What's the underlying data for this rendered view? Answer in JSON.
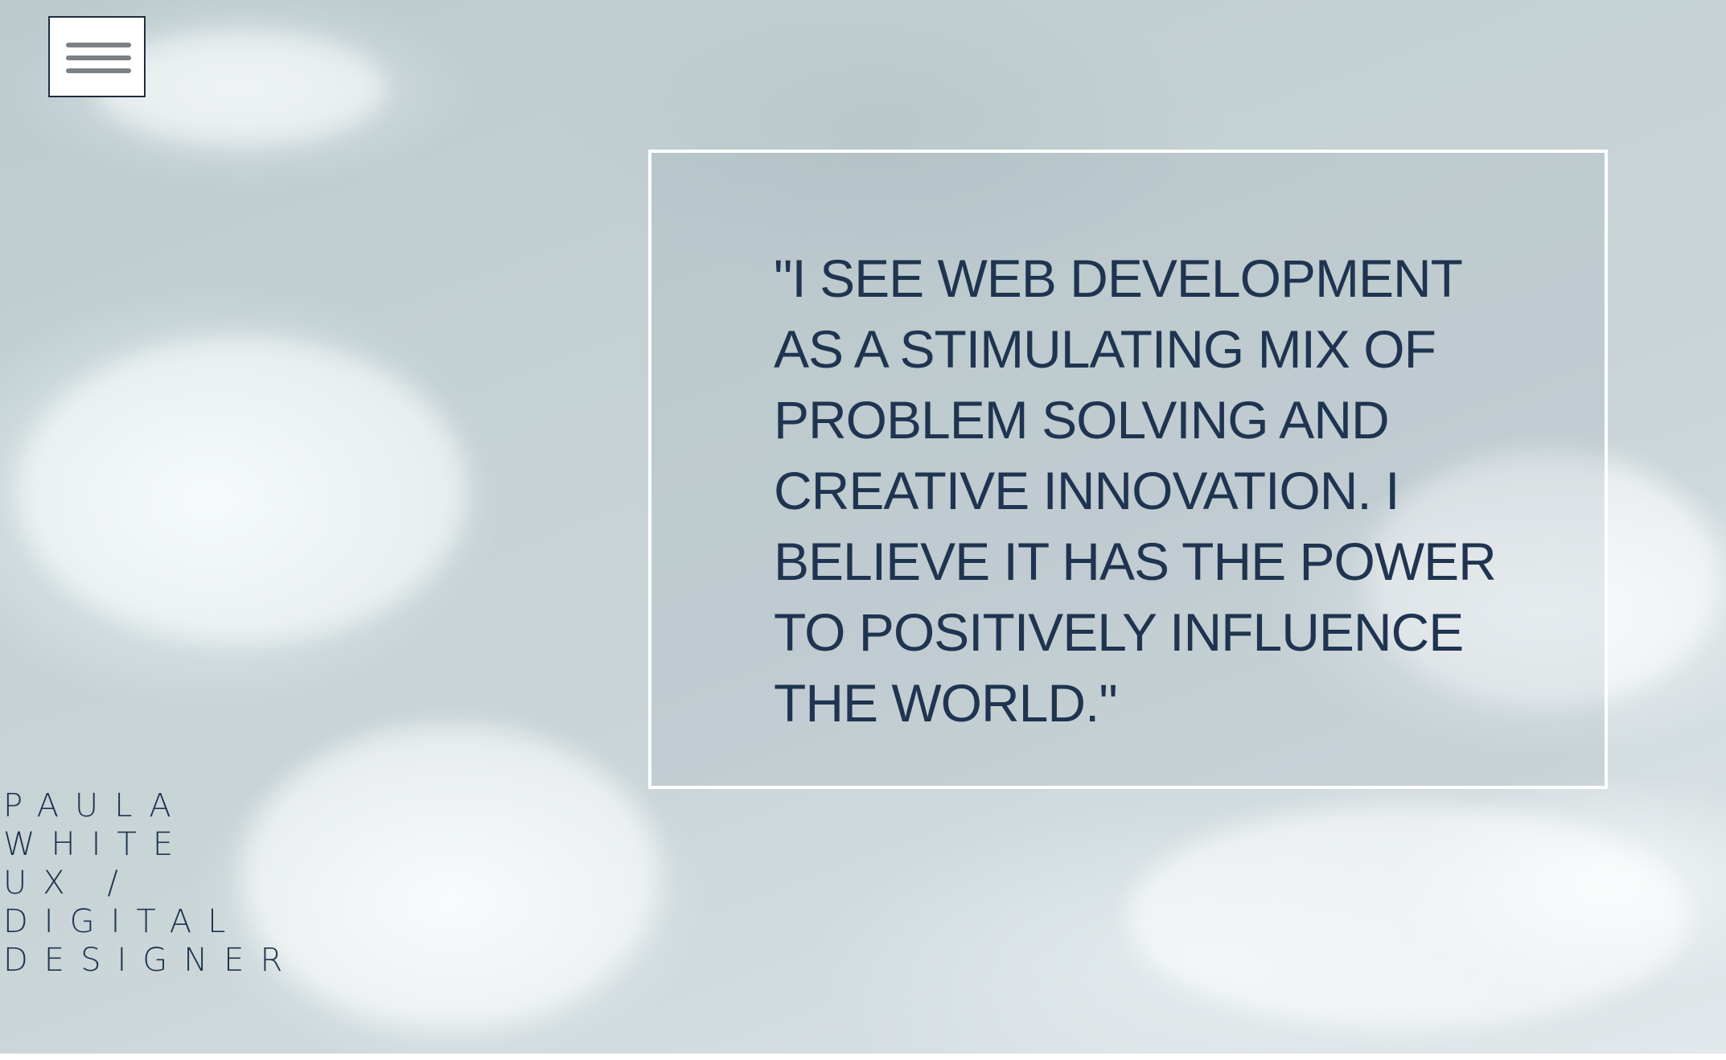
{
  "menu": {
    "icon": "hamburger-icon"
  },
  "quote": {
    "text": "\"I SEE WEB DEVELOPMENT AS A STIMULATING MIX OF PROBLEM SOLVING AND CREATIVE INNOVATION. I BELIEVE IT HAS THE POWER TO POSITIVELY INFLUENCE THE WORLD.\""
  },
  "profile": {
    "lines": [
      "PAULA",
      "WHITE",
      "UX /",
      "DIGITAL",
      "DESIGNER"
    ]
  },
  "colors": {
    "text": "#1f3450",
    "frame": "#ffffff",
    "menu_border": "#1f2d3d",
    "menu_bars": "#7b7f86"
  }
}
